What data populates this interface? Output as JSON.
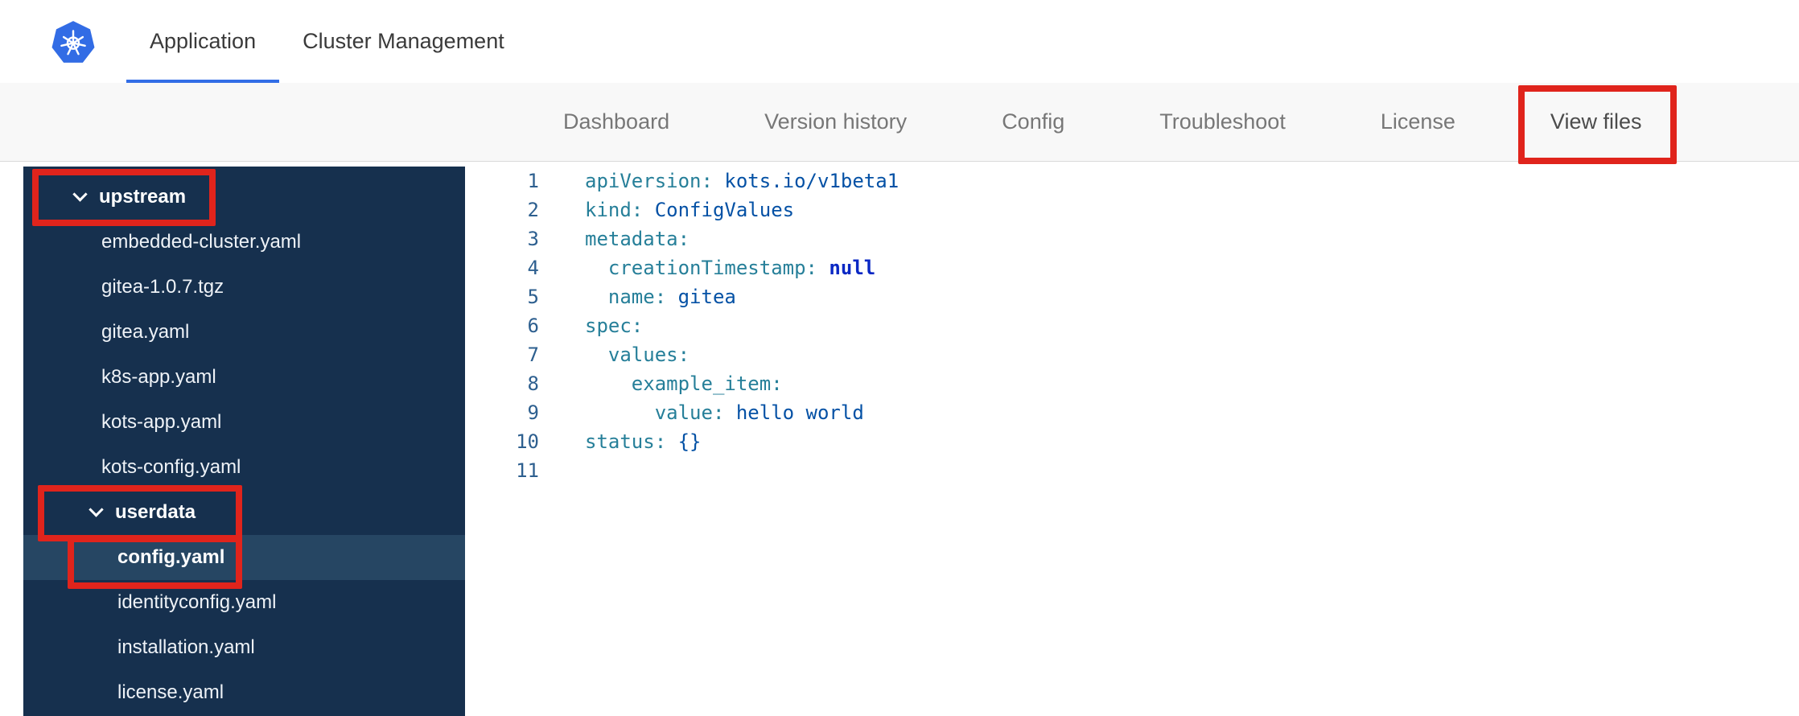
{
  "topbar": {
    "tabs": [
      {
        "label": "Application",
        "active": true
      },
      {
        "label": "Cluster Management",
        "active": false
      }
    ]
  },
  "subnav": {
    "items": [
      {
        "label": "Dashboard",
        "active": false
      },
      {
        "label": "Version history",
        "active": false
      },
      {
        "label": "Config",
        "active": false
      },
      {
        "label": "Troubleshoot",
        "active": false
      },
      {
        "label": "License",
        "active": false
      },
      {
        "label": "View files",
        "active": true
      }
    ]
  },
  "sidebar": {
    "items": [
      {
        "label": "upstream",
        "type": "folder",
        "level": 1,
        "expanded": true,
        "selected": false
      },
      {
        "label": "embedded-cluster.yaml",
        "type": "file",
        "level": 1,
        "selected": false
      },
      {
        "label": "gitea-1.0.7.tgz",
        "type": "file",
        "level": 1,
        "selected": false
      },
      {
        "label": "gitea.yaml",
        "type": "file",
        "level": 1,
        "selected": false
      },
      {
        "label": "k8s-app.yaml",
        "type": "file",
        "level": 1,
        "selected": false
      },
      {
        "label": "kots-app.yaml",
        "type": "file",
        "level": 1,
        "selected": false
      },
      {
        "label": "kots-config.yaml",
        "type": "file",
        "level": 1,
        "selected": false
      },
      {
        "label": "userdata",
        "type": "folder",
        "level": 2,
        "expanded": true,
        "selected": false
      },
      {
        "label": "config.yaml",
        "type": "file",
        "level": 2,
        "selected": true
      },
      {
        "label": "identityconfig.yaml",
        "type": "file",
        "level": 2,
        "selected": false
      },
      {
        "label": "installation.yaml",
        "type": "file",
        "level": 2,
        "selected": false
      },
      {
        "label": "license.yaml",
        "type": "file",
        "level": 2,
        "selected": false
      }
    ]
  },
  "editor": {
    "lines": [
      {
        "num": "1",
        "key": "apiVersion:",
        "value": " kots.io/v1beta1",
        "value_class": "val-str"
      },
      {
        "num": "2",
        "key": "kind:",
        "value": " ConfigValues",
        "value_class": "val-str"
      },
      {
        "num": "3",
        "key": "metadata:",
        "value": "",
        "value_class": "val-str"
      },
      {
        "num": "4",
        "key": "  creationTimestamp:",
        "value": " null",
        "value_class": "val-kw"
      },
      {
        "num": "5",
        "key": "  name:",
        "value": " gitea",
        "value_class": "val-str"
      },
      {
        "num": "6",
        "key": "spec:",
        "value": "",
        "value_class": "val-str"
      },
      {
        "num": "7",
        "key": "  values:",
        "value": "",
        "value_class": "val-str"
      },
      {
        "num": "8",
        "key": "    example_item:",
        "value": "",
        "value_class": "val-str"
      },
      {
        "num": "9",
        "key": "      value:",
        "value": " hello world",
        "value_class": "val-str"
      },
      {
        "num": "10",
        "key": "status:",
        "value": " {}",
        "value_class": "val-punc"
      },
      {
        "num": "11",
        "key": "",
        "value": "",
        "value_class": "val-str"
      }
    ]
  },
  "annotations": {
    "color": "#e0241c",
    "highlighted": [
      "upstream",
      "userdata",
      "config.yaml",
      "View files"
    ]
  },
  "colors": {
    "active_tab_blue": "#326de6",
    "sidebar_navy": "#16304e",
    "sidebar_selected": "#264663",
    "kubernetes_blue": "#326ce5",
    "annotation_red": "#e0241c",
    "yaml_key_teal": "#267f99",
    "yaml_value_blue": "#0451a5"
  }
}
